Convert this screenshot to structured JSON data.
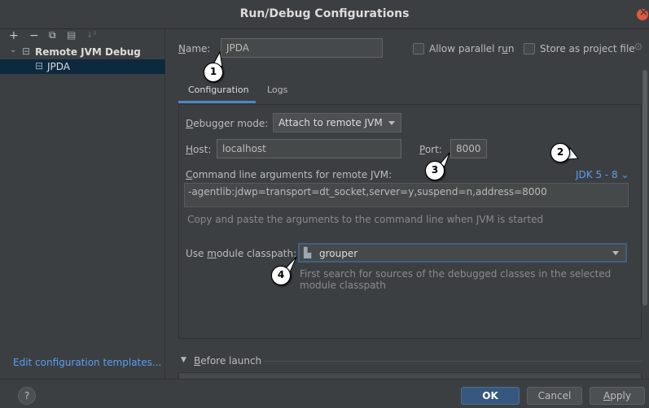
{
  "window": {
    "title": "Run/Debug Configurations"
  },
  "toolbar": {
    "add": "+",
    "remove": "−",
    "copy": "⧉",
    "move": "▤",
    "sort": "↓²"
  },
  "tree": {
    "group_label": "Remote JVM Debug",
    "item_label": "JPDA"
  },
  "left_footer": {
    "edit_templates": "Edit configuration templates..."
  },
  "name_row": {
    "label_prefix": "N",
    "label_rest": "ame:",
    "value": "JPDA",
    "allow_parallel_prefix": "Allow parallel r",
    "allow_parallel_u": "u",
    "allow_parallel_suffix": "n",
    "store_project": "Store as project file"
  },
  "tabs": [
    {
      "label": "Configuration"
    },
    {
      "label": "Logs"
    }
  ],
  "debugger_mode": {
    "label_u": "D",
    "label_rest": "ebugger mode:",
    "value": "Attach to remote JVM"
  },
  "host": {
    "label_u": "H",
    "label_rest": "ost:",
    "value": "localhost"
  },
  "port": {
    "label_u": "P",
    "label_rest": "ort:",
    "value": "8000"
  },
  "jdk": {
    "label": "JDK 5 - 8"
  },
  "cmd_args": {
    "label_u": "C",
    "label_rest": "ommand line arguments for remote JVM:",
    "value": "-agentlib:jdwp=transport=dt_socket,server=y,suspend=n,address=8000",
    "hint": "Copy and paste the arguments to the command line when JVM is started"
  },
  "module": {
    "label_prefix": "Use ",
    "label_u": "m",
    "label_rest": "odule classpath:",
    "value": "grouper",
    "hint_line1": "First search for sources of the debugged classes in the selected",
    "hint_line2": "module classpath"
  },
  "before_launch": {
    "label_u": "B",
    "label_rest": "efore launch"
  },
  "callouts": [
    "1",
    "2",
    "3",
    "4"
  ],
  "buttons": {
    "ok": "OK",
    "cancel": "Cancel",
    "apply_u": "A",
    "apply_rest": "pply",
    "help": "?"
  },
  "colors": {
    "accent": "#4a88c7",
    "link": "#589df6",
    "ok_button": "#365880",
    "close": "#e0583e"
  }
}
